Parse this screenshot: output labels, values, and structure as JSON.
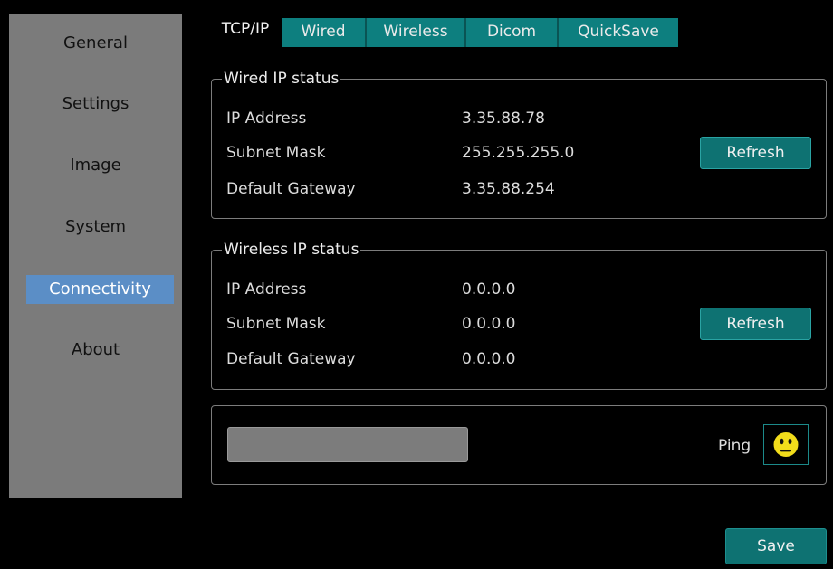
{
  "sidebar": {
    "items": [
      {
        "label": "General"
      },
      {
        "label": "Settings"
      },
      {
        "label": "Image"
      },
      {
        "label": "System"
      },
      {
        "label": "Connectivity"
      },
      {
        "label": "About"
      }
    ],
    "active": "Connectivity"
  },
  "tabs": [
    {
      "label": "TCP/IP"
    },
    {
      "label": "Wired"
    },
    {
      "label": "Wireless"
    },
    {
      "label": "Dicom"
    },
    {
      "label": "QuickSave"
    }
  ],
  "wired": {
    "title": "Wired IP status",
    "ip_label": "IP Address",
    "ip_value": "3.35.88.78",
    "mask_label": "Subnet Mask",
    "mask_value": "255.255.255.0",
    "gateway_label": "Default Gateway",
    "gateway_value": "3.35.88.254",
    "refresh_label": "Refresh"
  },
  "wireless": {
    "title": "Wireless IP status",
    "ip_label": "IP Address",
    "ip_value": "0.0.0.0",
    "mask_label": "Subnet Mask",
    "mask_value": "0.0.0.0",
    "gateway_label": "Default Gateway",
    "gateway_value": "0.0.0.0",
    "refresh_label": "Refresh"
  },
  "ping": {
    "input_value": "",
    "label": "Ping",
    "status_icon": "neutral-face-icon"
  },
  "footer": {
    "save_label": "Save"
  },
  "colors": {
    "accent_teal": "#0e7272",
    "active_nav": "#5b8ec6",
    "sidebar_bg": "#7b7b7b",
    "smiley": "#f2dd1b"
  }
}
